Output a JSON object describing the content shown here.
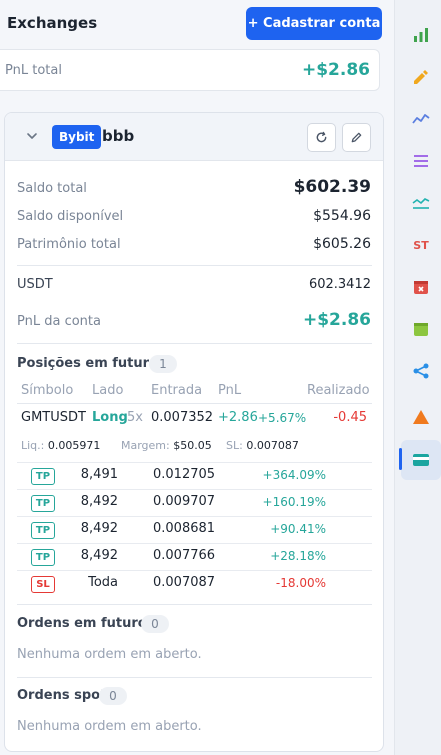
{
  "header": {
    "title": "Exchanges",
    "register_button": "+ Cadastrar conta"
  },
  "pnl_total": {
    "label": "PnL total",
    "value": "+$2.86"
  },
  "account": {
    "exchange": "Bybit",
    "name": "bbb",
    "saldo_total": {
      "label": "Saldo total",
      "value": "$602.39"
    },
    "saldo_disponivel": {
      "label": "Saldo disponível",
      "value": "$554.96"
    },
    "patrimonio_total": {
      "label": "Patrimônio total",
      "value": "$605.26"
    },
    "usdt": {
      "label": "USDT",
      "value": "602.3412"
    },
    "pnl_conta": {
      "label": "PnL da conta",
      "value": "+$2.86"
    }
  },
  "futures_positions": {
    "title": "Posições em futuros",
    "count": "1",
    "columns": [
      "Símbolo",
      "Lado",
      "Entrada",
      "PnL",
      "Realizado"
    ],
    "position": {
      "symbol": "GMTUSDT",
      "side": "Long",
      "leverage": "5x",
      "entry": "0.007352",
      "pnl": "+2.86",
      "pnl_pct": "+5.67%",
      "realized": "-0.45",
      "liq_label": "Liq.:",
      "liq_value": "0.005971",
      "margin_label": "Margem:",
      "margin_value": "$50.05",
      "sl_label": "SL:",
      "sl_value": "0.007087"
    },
    "targets": [
      {
        "tag": "TP",
        "qty": "8,491",
        "price": "0.012705",
        "pct": "+364.09%"
      },
      {
        "tag": "TP",
        "qty": "8,492",
        "price": "0.009707",
        "pct": "+160.19%"
      },
      {
        "tag": "TP",
        "qty": "8,492",
        "price": "0.008681",
        "pct": "+90.41%"
      },
      {
        "tag": "TP",
        "qty": "8,492",
        "price": "0.007766",
        "pct": "+28.18%"
      },
      {
        "tag": "SL",
        "qty": "Toda",
        "price": "0.007087",
        "pct": "-18.00%"
      }
    ]
  },
  "futures_orders": {
    "title": "Ordens em futuros",
    "count": "0",
    "empty": "Nenhuma ordem em aberto."
  },
  "spot_orders": {
    "title": "Ordens spot",
    "count": "0",
    "empty": "Nenhuma ordem em aberto."
  },
  "sidebar": {
    "icons": [
      "bar-chart-icon",
      "pencil-icon",
      "line-chart-icon",
      "indicator-icon",
      "wave-chart-icon",
      "st-icon",
      "calendar-x-icon",
      "calendar-icon",
      "share-icon",
      "triangle-icon",
      "card-icon"
    ],
    "st_text": "ST"
  },
  "colors": {
    "accent": "#1e63f0",
    "positive": "#26a69a",
    "negative": "#e53935"
  }
}
